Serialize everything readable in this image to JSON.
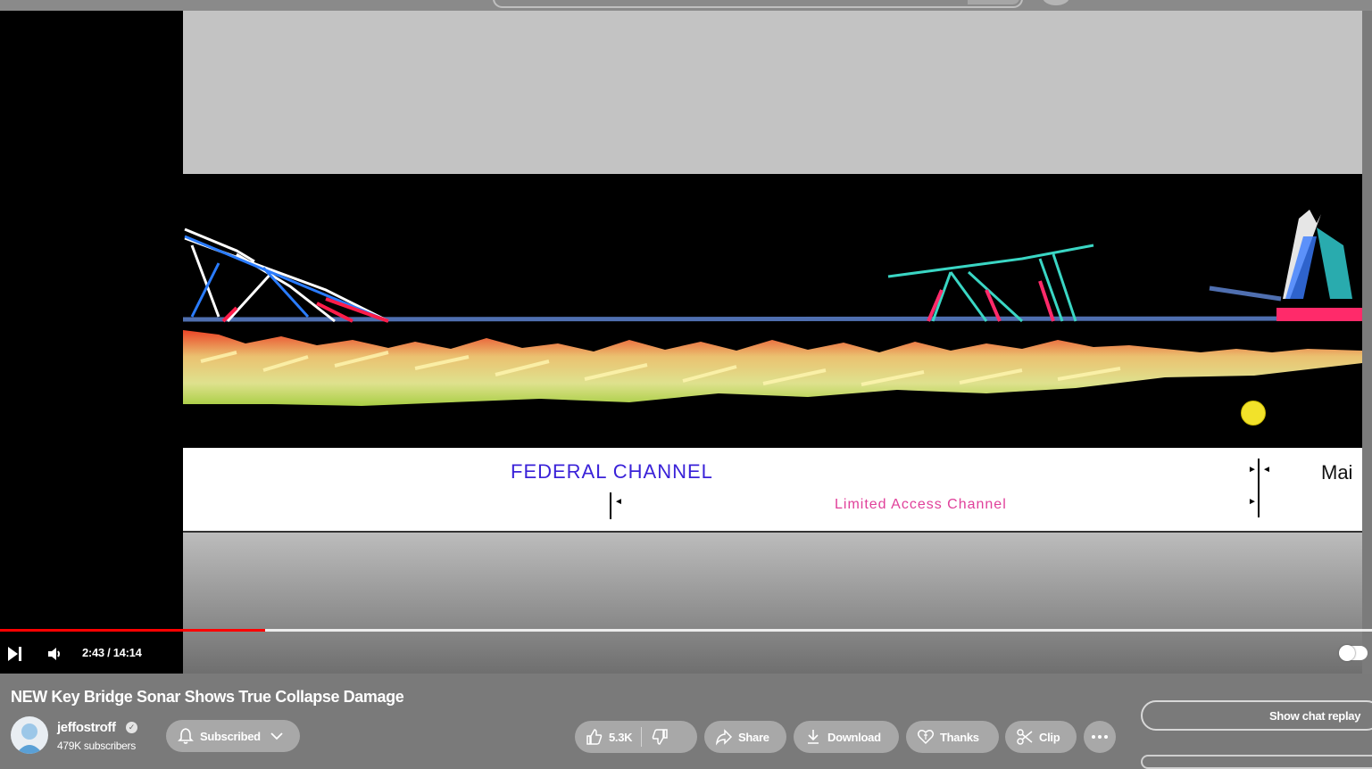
{
  "video": {
    "labels": {
      "federal": "FEDERAL CHANNEL",
      "limited": "Limited Access Channel",
      "main": "Mai"
    },
    "progress_fraction": 0.193,
    "time": "2:43 / 14:14",
    "accent_color": "#ff0000"
  },
  "meta": {
    "title": "NEW Key Bridge Sonar Shows True Collapse Damage",
    "channel": "jeffostroff",
    "subscribers": "479K subscribers",
    "verified_icon": "check-circle-icon"
  },
  "actions": {
    "subscribe_label": "Subscribed",
    "likes": "5.3K",
    "share_label": "Share",
    "download_label": "Download",
    "thanks_label": "Thanks",
    "clip_label": "Clip",
    "more_icon": "more-horizontal-icon"
  },
  "chat": {
    "button_label": "Show chat replay"
  }
}
